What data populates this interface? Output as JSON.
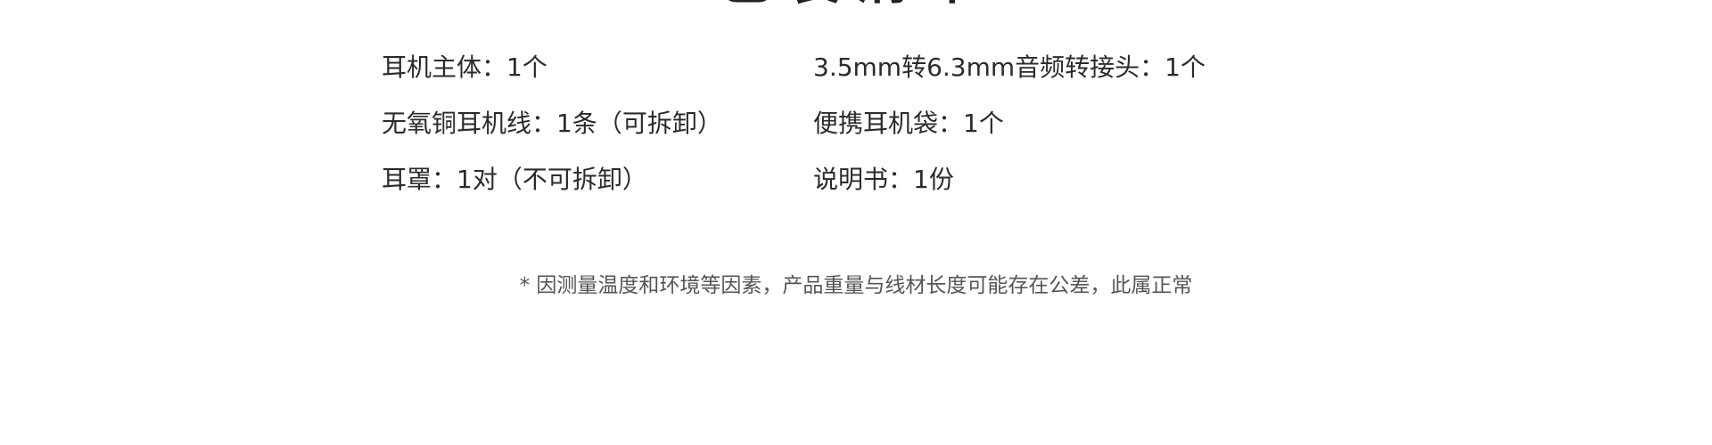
{
  "heading": "包装清单",
  "items": [
    "耳机主体：1个",
    "3.5mm转6.3mm音频转接头：1个",
    "无氧铜耳机线：1条（可拆卸）",
    "便携耳机袋：1个",
    "耳罩：1对（不可拆卸）",
    "说明书：1份"
  ],
  "note": "* 因测量温度和环境等因素，产品重量与线材长度可能存在公差，此属正常"
}
